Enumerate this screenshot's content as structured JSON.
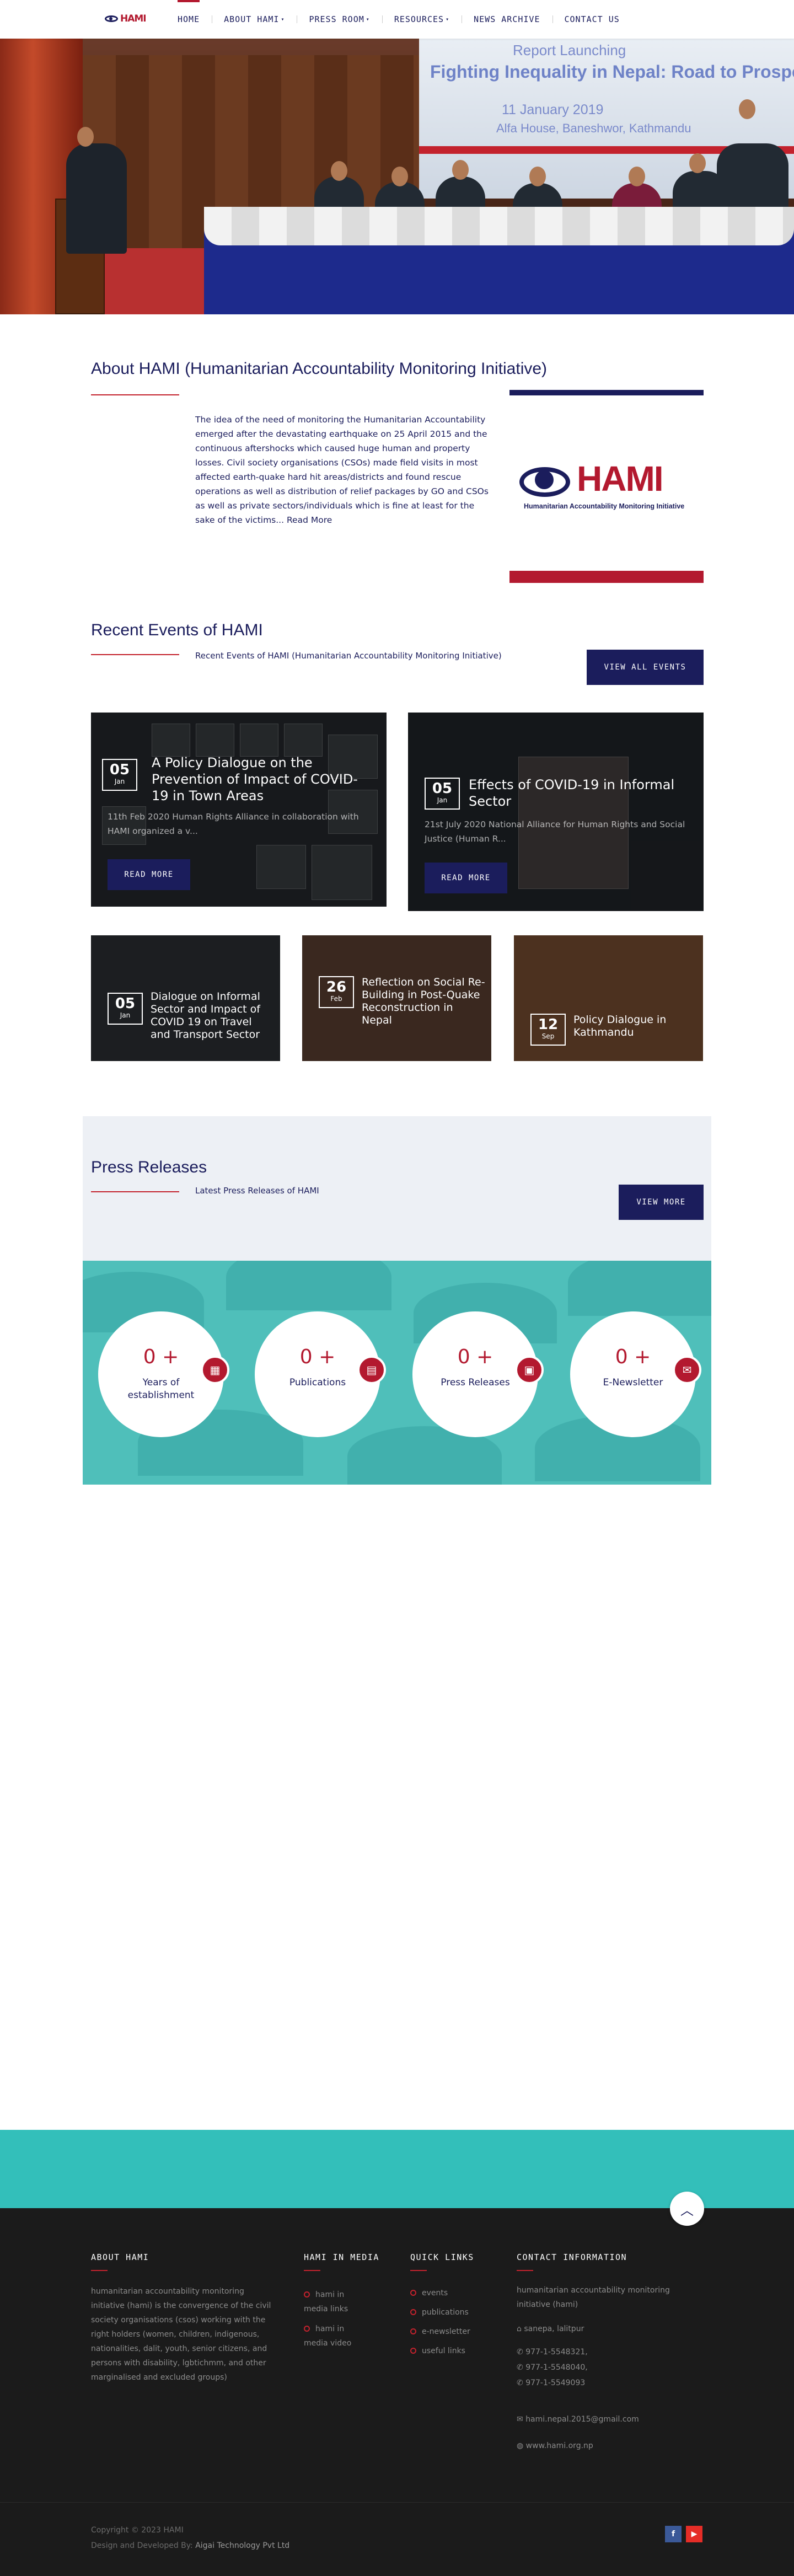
{
  "header": {
    "logo": "HAMI",
    "nav": [
      {
        "label": "Home",
        "active": true
      },
      {
        "label": "About HAMI",
        "caret": true
      },
      {
        "label": "Press Room",
        "caret": true
      },
      {
        "label": "Resources",
        "caret": true
      },
      {
        "label": "News Archive"
      },
      {
        "label": "Contact Us"
      }
    ],
    "caret_icon": "chevron-down-icon"
  },
  "hero": {
    "line1": "Report Launching",
    "line2": "Fighting Inequality in Nepal: Road to Prosperity",
    "date": "11 January  2019",
    "venue": "Alfa House, Baneshwor, Kathmandu"
  },
  "about": {
    "title": "About HAMI (Humanitarian Accountability Monitoring Initiative)",
    "body": "The idea of the need of monitoring the Humanitarian Accountability emerged after the devastating earthquake on 25 April 2015 and the continuous aftershocks which caused huge human and property losses. Civil society organisations (CSOs) made field visits in most affected earth-quake hard hit areas/districts and found rescue operations as well as distribution of relief packages by GO and CSOs as well as private sectors/individuals which is fine at least for the sake of the victims...",
    "read_more": "Read More",
    "logo_text": "HAMI",
    "logo_sub": "Humanitarian Accountability Monitoring Initiative"
  },
  "events": {
    "title": "Recent Events of HAMI",
    "subtitle": "Recent Events of HAMI (Humanitarian Accountability Monitoring Initiative)",
    "view_all": "View All Events",
    "featured": [
      {
        "day": "05",
        "month": "Jan",
        "title": "A Policy Dialogue on the Prevention of Impact of COVID-19 in Town Areas",
        "excerpt": "11th Feb 2020 Human Rights Alliance in collaboration with HAMI organized a v...",
        "button": "Read More"
      },
      {
        "day": "05",
        "month": "Jan",
        "title": "Effects of COVID-19 in Informal Sector",
        "excerpt": "21st July 2020 National Alliance for Human Rights and Social Justice (Human R...",
        "button": "Read More"
      }
    ],
    "small": [
      {
        "day": "05",
        "month": "Jan",
        "title": "Dialogue on Informal Sector and Impact of COVID 19 on Travel and Transport Sector"
      },
      {
        "day": "26",
        "month": "Feb",
        "title": "Reflection on Social Re-Building in Post-Quake Reconstruction in Nepal"
      },
      {
        "day": "12",
        "month": "Sep",
        "title": "Policy Dialogue in Kathmandu"
      }
    ]
  },
  "press": {
    "title": "Press Releases",
    "subtitle": "Latest Press Releases of HAMI",
    "button": "View More"
  },
  "counters": [
    {
      "value": "0 +",
      "label": "Years of establishment",
      "icon": "calendar-icon"
    },
    {
      "value": "0 +",
      "label": "Publications",
      "icon": "book-icon"
    },
    {
      "value": "0 +",
      "label": "Press Releases",
      "icon": "newspaper-icon"
    },
    {
      "value": "0 +",
      "label": "E-Newsletter",
      "icon": "newsletter-icon"
    }
  ],
  "footer": {
    "about_head": "About HAMI",
    "about_text": "humanitarian accountability monitoring initiative (hami) is the convergence of the civil society organisations (csos) working with the right holders (women, children, indigenous, nationalities, dalit, youth, senior citizens, and persons with disability, lgbtichmm, and other marginalised and excluded groups)",
    "media_head": "HAMI in media",
    "media_links": [
      "hami in media links",
      "hami in media video"
    ],
    "quick_head": "Quick links",
    "quick_links": [
      "events",
      "publications",
      "e-newsletter",
      "useful links"
    ],
    "contact_head": "Contact information",
    "contact_org": "humanitarian accountability monitoring initiative (hami)",
    "address": "sanepa, lalitpur",
    "phones": [
      "977-1-5548321,",
      "977-1-5548040,",
      "977-1-5549093"
    ],
    "email": "hami.nepal.2015@gmail.com",
    "website": "www.hami.org.np",
    "copyright": "Copyright © 2023 HAMI",
    "developed_prefix": "Design and Developed By:",
    "developer": "Aigai Technology Pvt Ltd",
    "social": [
      "facebook-icon",
      "youtube-icon"
    ],
    "colors": {
      "facebook": "#3b5998",
      "youtube": "#e52d27"
    }
  },
  "colors": {
    "navy": "#1b1d5c",
    "red": "#b3192f",
    "teal": "#4fbfba",
    "footer": "#1b1b1b"
  }
}
